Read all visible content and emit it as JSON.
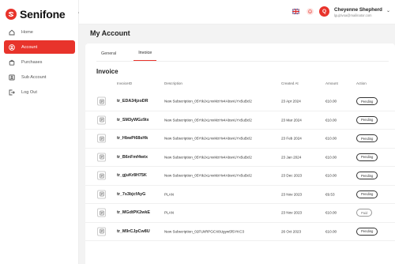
{
  "brand": {
    "name": "Senifone",
    "color": "#e8332b"
  },
  "sidebar": {
    "items": [
      {
        "label": "Home",
        "icon": "home-icon",
        "active": false
      },
      {
        "label": "Account",
        "icon": "user-circle-icon",
        "active": true
      },
      {
        "label": "Purchases",
        "icon": "shopping-bag-icon",
        "active": false
      },
      {
        "label": "Sub Account",
        "icon": "users-icon",
        "active": false
      },
      {
        "label": "Log Out",
        "icon": "logout-icon",
        "active": false
      }
    ]
  },
  "header": {
    "avatar_initial": "Q",
    "user_name": "Cheyenne Shepherd",
    "user_email": "lgujzivoa@mailinator.com"
  },
  "page": {
    "title": "My Account"
  },
  "tabs": [
    {
      "label": "General",
      "active": false
    },
    {
      "label": "Invoice",
      "active": true
    }
  ],
  "invoice": {
    "section_title": "Invoice",
    "columns": {
      "id": "InvoiceID",
      "description": "Description",
      "created": "Created At",
      "amount": "Amount",
      "action": "Action"
    },
    "rows": [
      {
        "id": "tr_EDA34jzoDR",
        "description": "New Subscription_05YtkJxLmxMzHv4AbsnUYx5uBcl2",
        "created": "23 Apr 2024",
        "amount": "€10.00",
        "status": "Pending"
      },
      {
        "id": "tr_SM3yWGz9ix",
        "description": "New Subscription_05YtkJxLmxMzHv4AbsnUYx5uBcl2",
        "created": "23 Mar 2024",
        "amount": "€10.00",
        "status": "Pending"
      },
      {
        "id": "tr_HbwPi68sHk",
        "description": "New Subscription_05YtkJxLmxMzHv4AbsnUYx5uBcl2",
        "created": "23 Feb 2024",
        "amount": "€10.00",
        "status": "Pending"
      },
      {
        "id": "tr_B6nFmf4wtx",
        "description": "New Subscription_05YtkJxLmxMzHv4AbsnUYx5uBcl2",
        "created": "23 Jan 2024",
        "amount": "€10.00",
        "status": "Pending"
      },
      {
        "id": "tr_gjuKr8H75K",
        "description": "New Subscription_05YtkJxLmxMzHv4AbsnUYx5uBcl2",
        "created": "23 Dec 2023",
        "amount": "€10.00",
        "status": "Pending"
      },
      {
        "id": "tr_7s3bjcfAyG",
        "description": "PLAN",
        "created": "23 Nov 2023",
        "amount": "€9.53",
        "status": "Pending"
      },
      {
        "id": "tr_MGdtPK2wkE",
        "description": "PLAN",
        "created": "23 Nov 2023",
        "amount": "€10.00",
        "status": "Paid"
      },
      {
        "id": "tr_M9rCJpCw8U",
        "description": "New Subscription_02FUkRPGCX8Ugyw5fSYKC3",
        "created": "26 Oct 2023",
        "amount": "€10.00",
        "status": "Pending"
      }
    ]
  }
}
